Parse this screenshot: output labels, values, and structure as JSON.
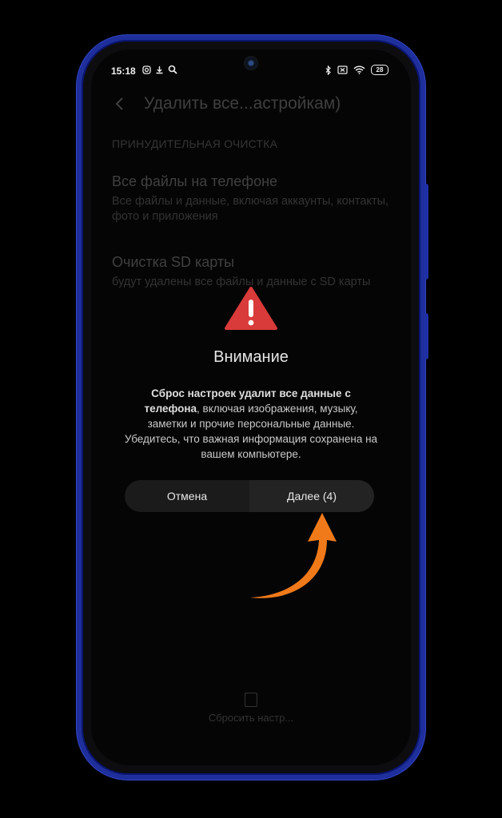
{
  "status_bar": {
    "time": "15:18",
    "battery": "28"
  },
  "background_page": {
    "title": "Удалить все...астройкам)",
    "section_label": "ПРИНУДИТЕЛЬНАЯ ОЧИСТКА",
    "items": [
      {
        "title": "Все файлы на телефоне",
        "subtitle": "Все файлы и данные, включая аккаунты, контакты, фото и приложения"
      },
      {
        "title": "Очистка SD карты",
        "subtitle": "будут удалены все файлы и данные с SD карты"
      }
    ],
    "bottom_action": "Сбросить настр..."
  },
  "dialog": {
    "title": "Внимание",
    "text_bold": "Сброс настроек удалит все данные с телефона",
    "text_rest": ", включая изображения, музыку, заметки и прочие персональные данные. Убедитесь, что важная информация сохранена на вашем компьютере.",
    "cancel_label": "Отмена",
    "next_label": "Далее (4)"
  },
  "colors": {
    "frame": "#1e2f9c",
    "warning": "#d93a3a",
    "arrow": "#f07a1a"
  },
  "icons": [
    "instagram-icon",
    "download-icon",
    "search-icon",
    "bluetooth-icon",
    "sim-off-icon",
    "wifi-icon",
    "battery-icon",
    "back-icon",
    "warning-icon",
    "reset-icon",
    "arrow-annotation-icon"
  ]
}
